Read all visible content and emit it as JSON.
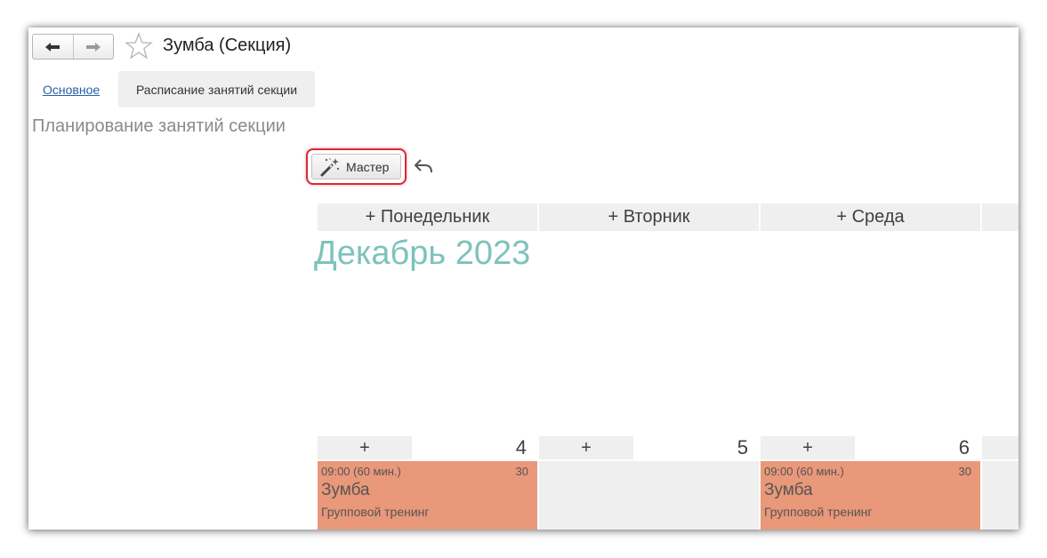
{
  "window": {
    "title": "Зумба (Секция)",
    "nav": {
      "back": "back",
      "forward": "forward"
    }
  },
  "tabs": [
    {
      "label": "Основное",
      "active": false
    },
    {
      "label": "Расписание занятий секции",
      "active": true
    }
  ],
  "section_title": "Планирование занятий секции",
  "toolbar": {
    "master_label": "Мастер",
    "undo": "undo"
  },
  "week_days": [
    "+ Понедельник",
    "+ Вторник",
    "+ Среда"
  ],
  "month_title": "Декабрь 2023",
  "days": [
    {
      "plus": "+",
      "number": "4",
      "event": {
        "time": "09:00 (60 мин.)",
        "count": "30",
        "name": "Зумба",
        "type": "Групповой тренинг"
      }
    },
    {
      "plus": "+",
      "number": "5",
      "event": null
    },
    {
      "plus": "+",
      "number": "6",
      "event": {
        "time": "09:00 (60 мин.)",
        "count": "30",
        "name": "Зумба",
        "type": "Групповой тренинг"
      }
    }
  ],
  "colors": {
    "event": "#e9987a",
    "month": "#7dc3bb",
    "highlight": "#d62b35",
    "link": "#2a5fa8"
  }
}
